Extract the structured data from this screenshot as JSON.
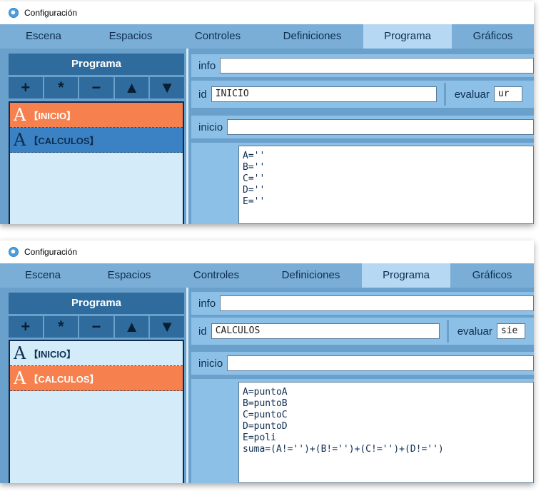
{
  "windows": [
    {
      "title": "Configuración",
      "tabs": [
        "Escena",
        "Espacios",
        "Controles",
        "Definiciones",
        "Programa",
        "Gráficos"
      ],
      "active_tab": "Programa",
      "panel_title": "Programa",
      "toolbar": [
        "+",
        "*",
        "−",
        "▲",
        "▼"
      ],
      "items": [
        {
          "glyph": "A",
          "label": "【INICIO】",
          "state": "selected"
        },
        {
          "glyph": "A",
          "label": "【CALCULOS】",
          "state": "highlight"
        }
      ],
      "info_label": "info",
      "info_value": "",
      "id_label": "id",
      "id_value": "INICIO",
      "evaluar_label": "evaluar",
      "evaluar_value": "ur",
      "inicio_label": "inicio",
      "inicio_value": "",
      "code": [
        "A=''",
        "B=''",
        "C=''",
        "D=''",
        "E=''"
      ]
    },
    {
      "title": "Configuración",
      "tabs": [
        "Escena",
        "Espacios",
        "Controles",
        "Definiciones",
        "Programa",
        "Gráficos"
      ],
      "active_tab": "Programa",
      "panel_title": "Programa",
      "toolbar": [
        "+",
        "*",
        "−",
        "▲",
        "▼"
      ],
      "items": [
        {
          "glyph": "A",
          "label": "【INICIO】",
          "state": "normal"
        },
        {
          "glyph": "A",
          "label": "【CALCULOS】",
          "state": "selected"
        }
      ],
      "info_label": "info",
      "info_value": "",
      "id_label": "id",
      "id_value": "CALCULOS",
      "evaluar_label": "evaluar",
      "evaluar_value": "sie",
      "inicio_label": "inicio",
      "inicio_value": "",
      "code": [
        "A=puntoA",
        "B=puntoB",
        "C=puntoC",
        "D=puntoD",
        "E=poli",
        "suma=(A!='')+(B!='')+(C!='')+(D!='')"
      ]
    }
  ]
}
